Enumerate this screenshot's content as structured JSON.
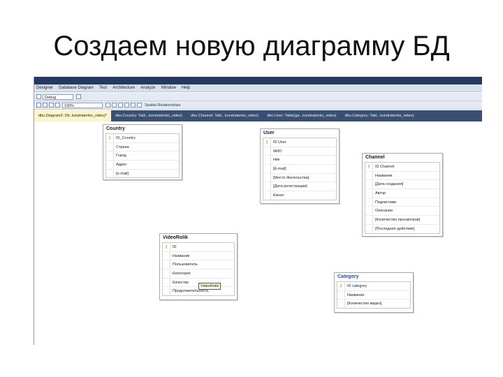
{
  "slide_title": "Создаем новую диаграмму БД",
  "menubar": [
    "Designer",
    "Database Diagram",
    "Test",
    "Architecture",
    "Analyze",
    "Window",
    "Help"
  ],
  "toolbar": {
    "config_value": "Debug",
    "zoom_value": "100%",
    "extra_label": "Spatial Relationships"
  },
  "tabs": [
    "dbo.Diagram2: Db..kondratenko_video)*",
    "dbo.Country: Tabl...kondratenko_video)",
    "dbo.Channel: Tabl...kondratenko_video)",
    "dbo.User: Table(ga...kondratenko_video)",
    "dbo.Category: Tabl...kondratenko_video)"
  ],
  "tables": {
    "country": {
      "title": "Country",
      "rows": [
        {
          "name": "ID_Country",
          "key": true
        },
        {
          "name": "Страна",
          "key": false
        },
        {
          "name": "Город",
          "key": false
        },
        {
          "name": "Адрес",
          "key": false
        },
        {
          "name": "[e-mail]",
          "key": false
        }
      ]
    },
    "user": {
      "title": "User",
      "rows": [
        {
          "name": "ID User",
          "key": true
        },
        {
          "name": "ФИО",
          "key": false
        },
        {
          "name": "Ник",
          "key": false
        },
        {
          "name": "[E-mail]",
          "key": false
        },
        {
          "name": "[Место Жительства]",
          "key": false
        },
        {
          "name": "[Дата регистрации]",
          "key": false
        },
        {
          "name": "Канал",
          "key": false
        }
      ]
    },
    "channel": {
      "title": "Channel",
      "rows": [
        {
          "name": "ID Channel",
          "key": true
        },
        {
          "name": "Название",
          "key": false
        },
        {
          "name": "[Дата создания]",
          "key": false
        },
        {
          "name": "Автор",
          "key": false
        },
        {
          "name": "Подписчики",
          "key": false
        },
        {
          "name": "Описание",
          "key": false
        },
        {
          "name": "[Количество просмотров]",
          "key": false
        },
        {
          "name": "[Последнее действие]",
          "key": false
        }
      ]
    },
    "videorolik": {
      "title": "VideoRolik",
      "rows": [
        {
          "name": "ID",
          "key": true
        },
        {
          "name": "Название",
          "key": false
        },
        {
          "name": "Пользователь",
          "key": false
        },
        {
          "name": "Категория",
          "key": false
        },
        {
          "name": "Качество",
          "key": false
        },
        {
          "name": "Продолжительность",
          "key": false
        }
      ]
    },
    "category": {
      "title": "Category",
      "rows": [
        {
          "name": "ID category",
          "key": true
        },
        {
          "name": "Название",
          "key": false
        },
        {
          "name": "[Количество видео]",
          "key": false
        }
      ]
    }
  },
  "tooltip": "VideoRolik",
  "icons": {
    "key": "key-icon",
    "color_key": "#c49a00"
  }
}
